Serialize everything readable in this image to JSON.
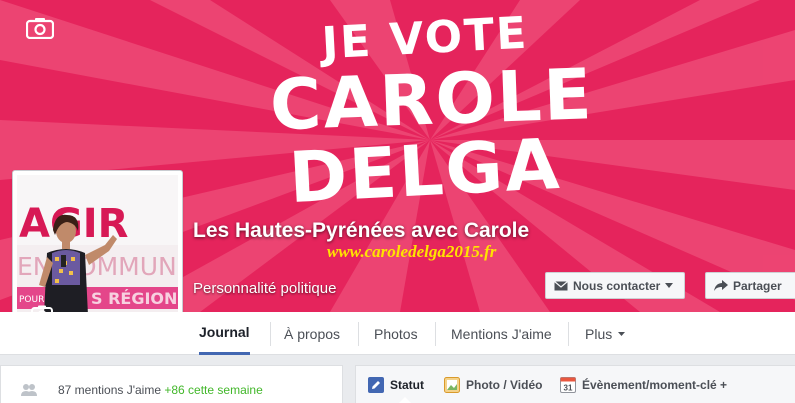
{
  "cover": {
    "line1": "JE VOTE",
    "line2": "CAROLE",
    "line3": "DELGA",
    "url": "www.caroledelga2015.fr"
  },
  "avatar": {
    "sign_line1": "AGIR",
    "sign_line2": "EN COMMUN",
    "sign_line3": "POUR",
    "sign_line4": "S RÉGION"
  },
  "page": {
    "name": "Les Hautes-Pyrénées avec Carole",
    "category": "Personnalité politique"
  },
  "buttons": {
    "contact": "Nous contacter",
    "share": "Partager"
  },
  "tabs": [
    {
      "label": "Journal"
    },
    {
      "label": "À propos"
    },
    {
      "label": "Photos"
    },
    {
      "label": "Mentions J'aime"
    },
    {
      "label": "Plus"
    }
  ],
  "likes": {
    "count_text": "87 mentions J'aime",
    "week_text": "+86 cette semaine"
  },
  "composer": {
    "status": "Statut",
    "photo_video": "Photo / Vidéo",
    "event": "Évènement/moment-clé +",
    "calendar_day": "31"
  },
  "colors": {
    "cover_red": "#e5245c",
    "url_yellow": "#ffe300",
    "accent_blue": "#4267b2",
    "likes_green": "#42b72a"
  }
}
